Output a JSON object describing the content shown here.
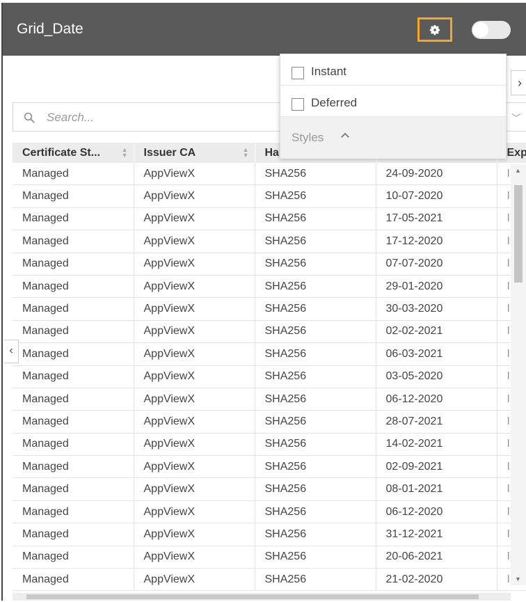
{
  "window": {
    "title": "Grid_Date"
  },
  "header": {
    "gear_icon": "gear-icon",
    "toggle_state": "off"
  },
  "search": {
    "placeholder": "Search..."
  },
  "dropdown": {
    "items": [
      {
        "label": "Instant",
        "checked": false
      },
      {
        "label": "Deferred",
        "checked": false
      }
    ],
    "styles_label": "Styles"
  },
  "grid": {
    "columns": [
      "Certificate St...",
      "Issuer CA",
      "Ha",
      "",
      "Exp"
    ],
    "rows": [
      [
        "Managed",
        "AppViewX",
        "SHA256",
        "24-09-2020"
      ],
      [
        "Managed",
        "AppViewX",
        "SHA256",
        "10-07-2020"
      ],
      [
        "Managed",
        "AppViewX",
        "SHA256",
        "17-05-2021"
      ],
      [
        "Managed",
        "AppViewX",
        "SHA256",
        "17-12-2020"
      ],
      [
        "Managed",
        "AppViewX",
        "SHA256",
        "07-07-2020"
      ],
      [
        "Managed",
        "AppViewX",
        "SHA256",
        "29-01-2020"
      ],
      [
        "Managed",
        "AppViewX",
        "SHA256",
        "30-03-2020"
      ],
      [
        "Managed",
        "AppViewX",
        "SHA256",
        "02-02-2021"
      ],
      [
        "Managed",
        "AppViewX",
        "SHA256",
        "06-03-2021"
      ],
      [
        "Managed",
        "AppViewX",
        "SHA256",
        "03-05-2020"
      ],
      [
        "Managed",
        "AppViewX",
        "SHA256",
        "06-12-2020"
      ],
      [
        "Managed",
        "AppViewX",
        "SHA256",
        "28-07-2021"
      ],
      [
        "Managed",
        "AppViewX",
        "SHA256",
        "14-02-2021"
      ],
      [
        "Managed",
        "AppViewX",
        "SHA256",
        "02-09-2021"
      ],
      [
        "Managed",
        "AppViewX",
        "SHA256",
        "08-01-2021"
      ],
      [
        "Managed",
        "AppViewX",
        "SHA256",
        "06-12-2020"
      ],
      [
        "Managed",
        "AppViewX",
        "SHA256",
        "31-12-2021"
      ],
      [
        "Managed",
        "AppViewX",
        "SHA256",
        "20-06-2021"
      ],
      [
        "Managed",
        "AppViewX",
        "SHA256",
        "21-02-2020"
      ]
    ]
  },
  "colors": {
    "titlebar": "#5a5a5a",
    "highlight": "#f5a623",
    "header_bg": "#ececec"
  }
}
